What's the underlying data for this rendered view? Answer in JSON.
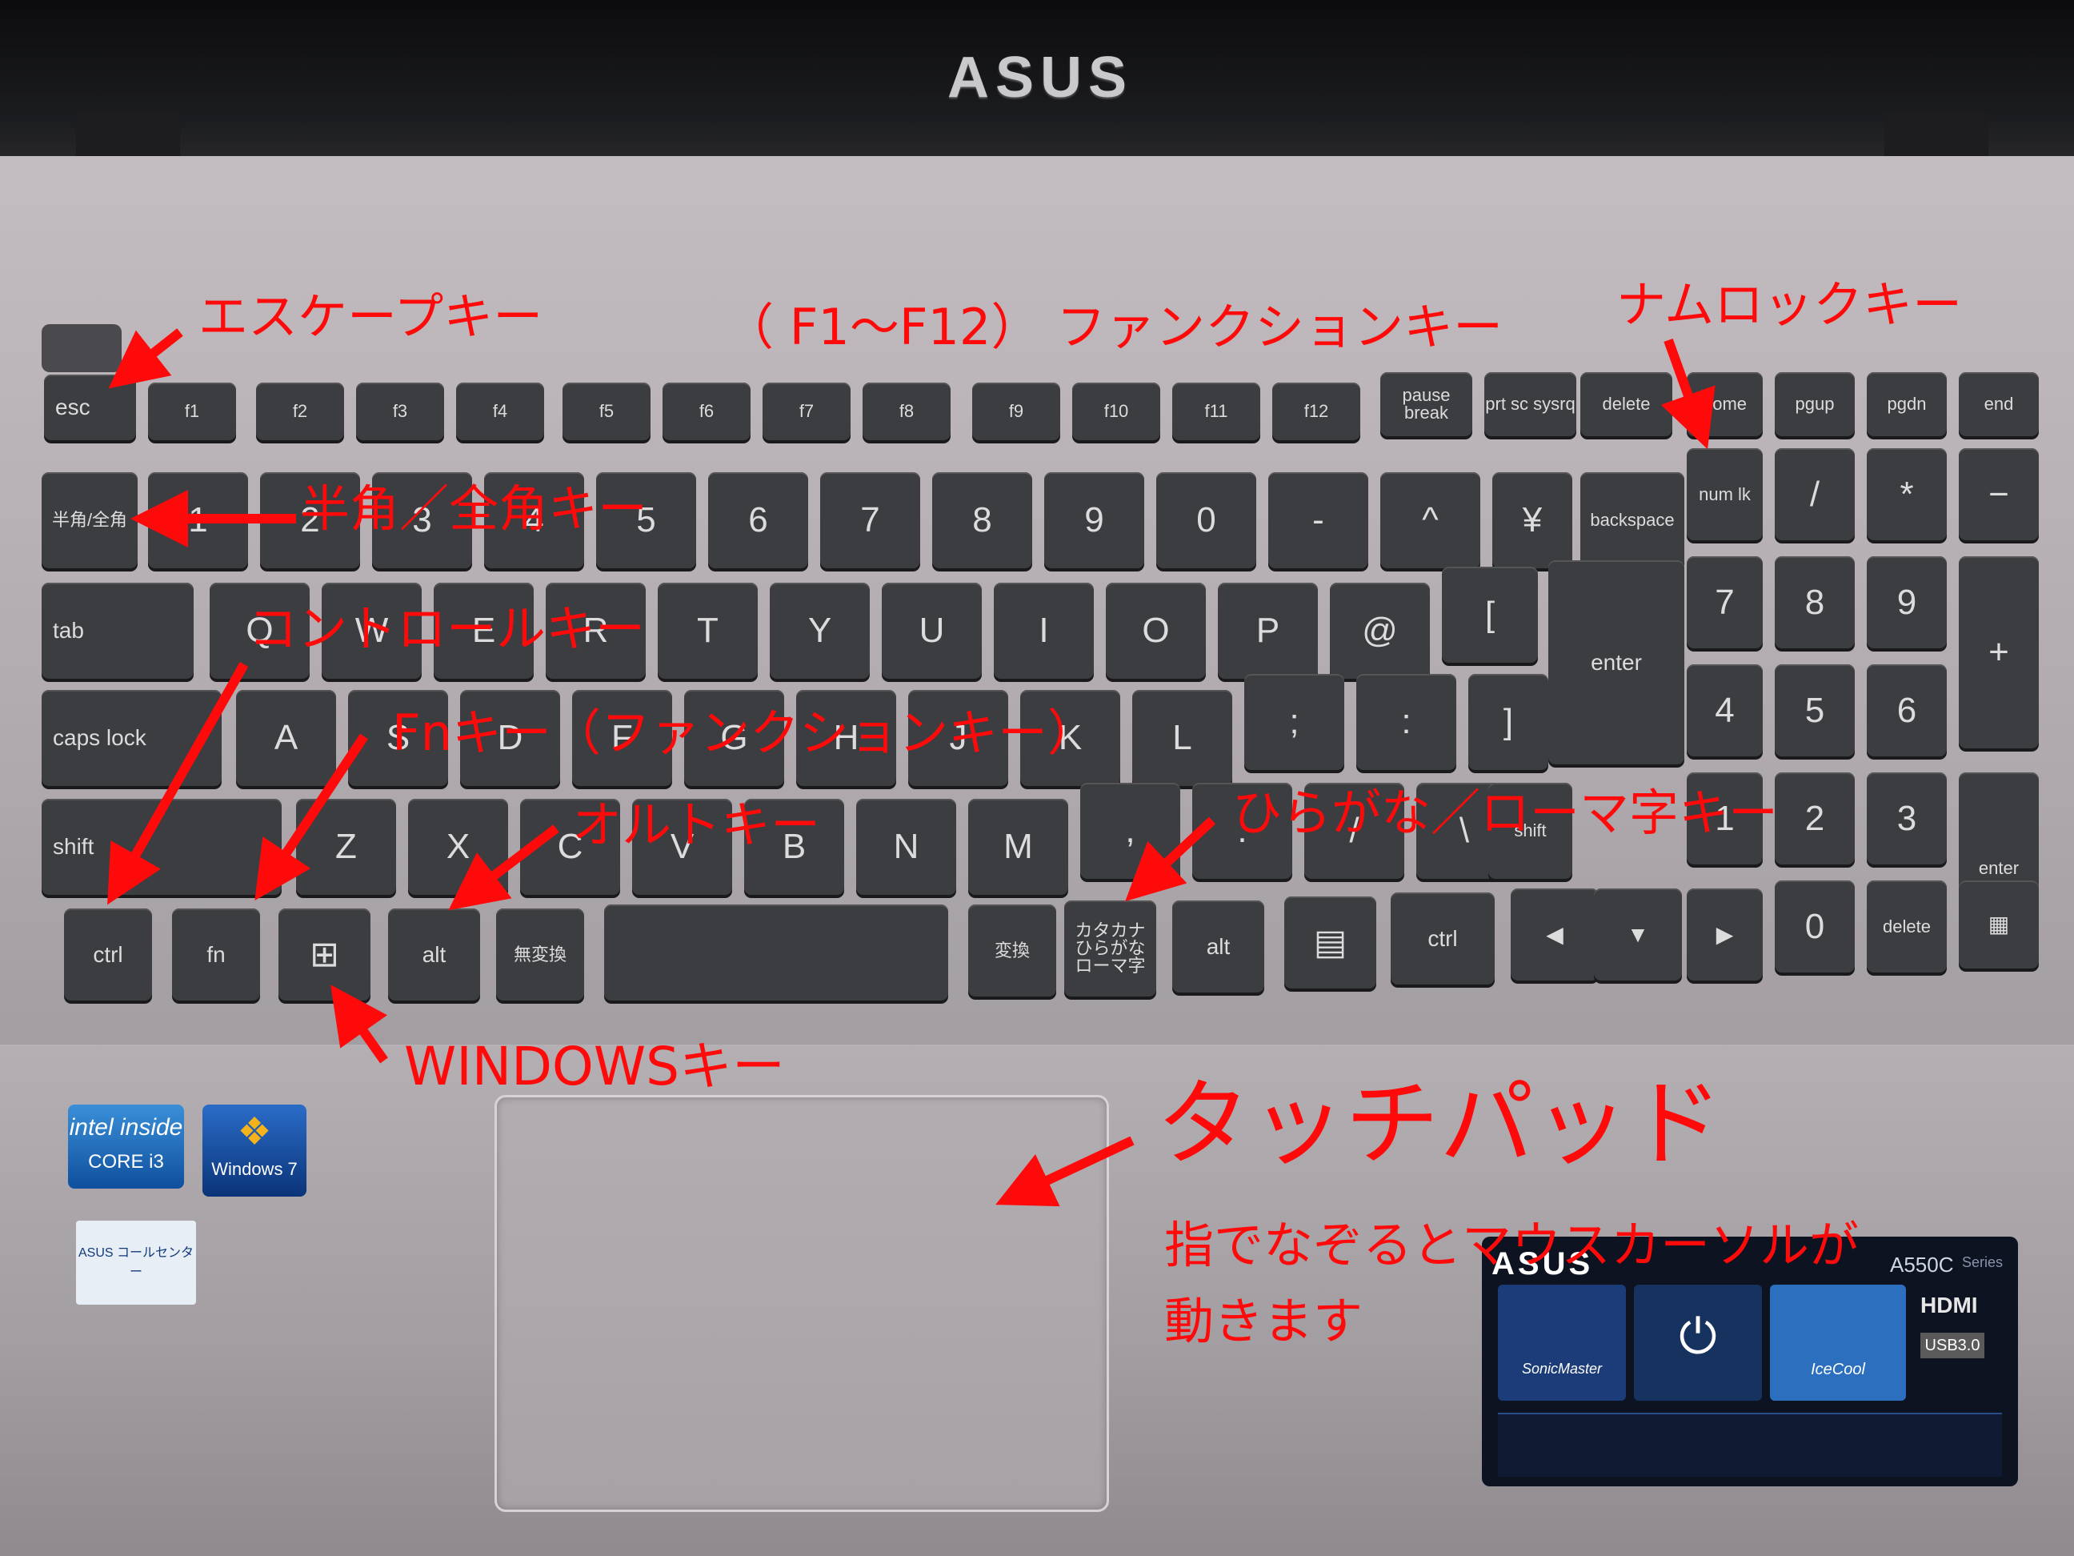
{
  "brand": "ASUS",
  "annotations": {
    "escape": "エスケープキー",
    "function_keys": "（ F1～F12） ファンクションキー",
    "numlock": "ナムロックキー",
    "hankaku": "半角／全角キー",
    "control": "コントロールキー",
    "fn": "Fnキー（ファンクションキー）",
    "alt": "オルトキー",
    "hiragana": "ひらがな／ローマ字キー",
    "windows": "WINDOWSキー",
    "touchpad": "タッチパッド",
    "touchpad_desc_1": "指でなぞるとマウスカーソルが",
    "touchpad_desc_2": "動きます"
  },
  "keys": {
    "esc": "esc",
    "f1": "f1",
    "f2": "f2",
    "f3": "f3",
    "f4": "f4",
    "f5": "f5",
    "f6": "f6",
    "f7": "f7",
    "f8": "f8",
    "f9": "f9",
    "f10": "f10",
    "f11": "f11",
    "f12": "f12",
    "pause": "pause break",
    "prtsc": "prt sc sysrq",
    "delete": "delete",
    "home": "home",
    "pgup": "pgup",
    "pgdn": "pgdn",
    "end": "end",
    "hanzen": "半角/全角",
    "n1": "1",
    "n2": "2",
    "n3": "3",
    "n4": "4",
    "n5": "5",
    "n6": "6",
    "n7": "7",
    "n8": "8",
    "n9": "9",
    "n0": "0",
    "minus": "-",
    "caret": "^",
    "yen": "¥",
    "backspace": "backspace",
    "numlk": "num lk",
    "slash": "/",
    "star": "*",
    "dash": "−",
    "tab": "tab",
    "q": "Q",
    "w": "W",
    "e": "E",
    "r": "R",
    "t": "T",
    "y": "Y",
    "u": "U",
    "i": "I",
    "o": "O",
    "p": "P",
    "at": "@",
    "bracket": "[",
    "enter": "enter",
    "np7": "7",
    "np8": "8",
    "np9": "9",
    "plus": "+",
    "caps": "caps lock",
    "a": "A",
    "s": "S",
    "d": "D",
    "f": "F",
    "g": "G",
    "h": "H",
    "j": "J",
    "k": "K",
    "l": "L",
    "semi": ";",
    "colon": ":",
    "rbracket": "]",
    "np4": "4",
    "np5": "5",
    "np6": "6",
    "shift": "shift",
    "z": "Z",
    "x": "X",
    "c": "C",
    "v": "V",
    "b": "B",
    "n": "N",
    "m": "M",
    "comma": ",",
    "period": ".",
    "slash2": "/",
    "ro": "\\",
    "rshift": "shift",
    "np1": "1",
    "np2": "2",
    "np3": "3",
    "npenter": "enter",
    "ctrl": "ctrl",
    "fn": "fn",
    "win": "⊞",
    "alt": "alt",
    "muhenkan": "無変換",
    "space": "",
    "henkan": "変換",
    "kana": "カタカナ ひらがな ローマ字",
    "ralt": "alt",
    "menu": "▤",
    "rctrl": "ctrl",
    "left": "◀",
    "down": "▼",
    "right": "▶",
    "np0": "0",
    "npdel": "delete",
    "calc": "▦"
  },
  "stickers": {
    "intel": "intel inside",
    "intel_core": "CORE i3",
    "windows": "Windows 7",
    "asus_support": "ASUS コールセンター",
    "model": "A550C",
    "series": "Series",
    "hdmi": "HDMI",
    "usb": "USB3.0",
    "sonicmaster": "SonicMaster",
    "icecool": "IceCool"
  }
}
